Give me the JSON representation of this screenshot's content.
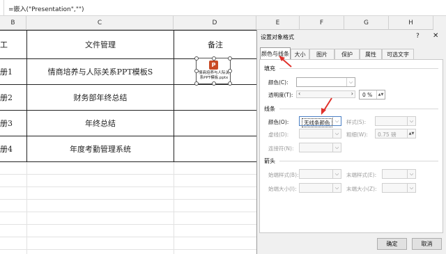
{
  "formula_bar": {
    "text": "=嵌入(\"Presentation\",\"\")"
  },
  "sheet": {
    "columns": [
      "B",
      "C",
      "D"
    ],
    "header_row": [
      "工",
      "文件管理",
      "备注"
    ],
    "rows": [
      {
        "b": "册1",
        "c": "情商培养与人际关系PPT模板S"
      },
      {
        "b": "册2",
        "c": "财务部年终总结"
      },
      {
        "b": "册3",
        "c": "年终总结"
      },
      {
        "b": "册4",
        "c": "年度考勤管理系统"
      }
    ],
    "right_columns": [
      "E",
      "F",
      "G",
      "H"
    ],
    "embedded_object": {
      "icon": "powerpoint-icon",
      "icon_letter": "P",
      "label": "情商培养与人际关系PPT模板.pptx"
    }
  },
  "dialog": {
    "title": "设置对象格式",
    "help": "?",
    "close": "✕",
    "tabs": [
      "颜色与线条",
      "大小",
      "图片",
      "保护",
      "属性",
      "可选文字"
    ],
    "active_tab": "颜色与线条",
    "fill": {
      "section": "填充",
      "color_label": "颜色(C):",
      "transparency_label": "透明度(T):",
      "transparency_value": "0 %",
      "color_value": ""
    },
    "line": {
      "section": "线条",
      "color_label": "颜色(O):",
      "color_value": "无线条颜色",
      "dash_label": "虚线(D):",
      "connector_label": "连接符(N):",
      "style_label": "样式(S):",
      "weight_label": "粗细(W):",
      "weight_value": "0.75 磅"
    },
    "arrows": {
      "section": "箭头",
      "begin_style_label": "始端样式(B):",
      "begin_size_label": "始端大小(I):",
      "end_style_label": "末端样式(E):",
      "end_size_label": "末端大小(Z):"
    },
    "ok_label": "确定",
    "cancel_label": "取消"
  },
  "colors": {
    "annotation_arrow": "#e0312b",
    "ppt_icon": "#c94a25"
  }
}
